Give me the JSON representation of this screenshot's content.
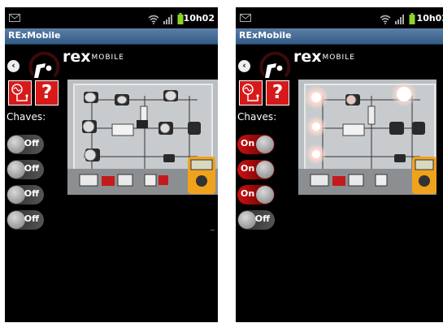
{
  "left": {
    "status_time": "10h02",
    "app_title": "RExMobile",
    "brand": "rex",
    "brand_sub": "MOBILE",
    "help_label": "?",
    "switches_label": "Chaves:",
    "switches": [
      {
        "label": "Off",
        "state": "off"
      },
      {
        "label": "Off",
        "state": "off"
      },
      {
        "label": "Off",
        "state": "off"
      },
      {
        "label": "Off",
        "state": "off"
      }
    ]
  },
  "right": {
    "status_time": "10h02",
    "app_title": "RExMobile",
    "brand": "rex",
    "brand_sub": "MOBILE",
    "help_label": "?",
    "switches_label": "Chaves:",
    "switches": [
      {
        "label": "On",
        "state": "on"
      },
      {
        "label": "On",
        "state": "on"
      },
      {
        "label": "On",
        "state": "on"
      },
      {
        "label": "Off",
        "state": "off"
      }
    ]
  },
  "colors": {
    "accent": "#d71919",
    "titlebar": "#345b86",
    "on_track": "#cc1111"
  }
}
